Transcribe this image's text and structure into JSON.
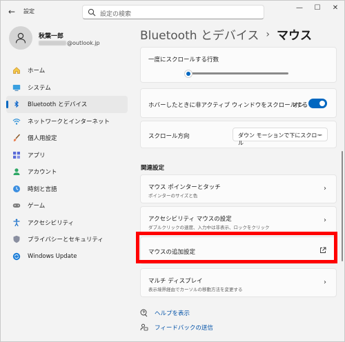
{
  "titlebar": {
    "app_title": "設定",
    "search_placeholder": "設定の検索",
    "back_glyph": "←",
    "minimize_glyph": "—",
    "maximize_glyph": "☐",
    "close_glyph": "✕"
  },
  "profile": {
    "name": "秋葉一郎",
    "email_suffix": "@outlook.jp"
  },
  "sidebar": {
    "items": [
      {
        "label": "ホーム",
        "icon": "home-icon"
      },
      {
        "label": "システム",
        "icon": "system-icon"
      },
      {
        "label": "Bluetooth とデバイス",
        "icon": "bluetooth-icon",
        "active": true
      },
      {
        "label": "ネットワークとインターネット",
        "icon": "network-icon"
      },
      {
        "label": "個人用設定",
        "icon": "brush-icon"
      },
      {
        "label": "アプリ",
        "icon": "apps-icon"
      },
      {
        "label": "アカウント",
        "icon": "account-icon"
      },
      {
        "label": "時刻と言語",
        "icon": "time-language-icon"
      },
      {
        "label": "ゲーム",
        "icon": "gaming-icon"
      },
      {
        "label": "アクセシビリティ",
        "icon": "accessibility-icon"
      },
      {
        "label": "プライバシーとセキュリティ",
        "icon": "shield-icon"
      },
      {
        "label": "Windows Update",
        "icon": "windows-update-icon"
      }
    ]
  },
  "header": {
    "parent": "Bluetooth とデバイス",
    "separator": "›",
    "current": "マウス"
  },
  "settings": {
    "scroll_lines_label": "一度にスクロールする行数",
    "scroll_lines_value_fraction": 0.03,
    "hover_scroll_label": "ホバーしたときに非アクティブ ウィンドウをスクロールする",
    "hover_scroll_state": "オン",
    "scroll_direction_label": "スクロール方向",
    "scroll_direction_value": "ダウン モーションで下にスクロール"
  },
  "related": {
    "title": "関連設定",
    "pointer_title": "マウス ポインターとタッチ",
    "pointer_sub": "ポインターのサイズと色",
    "accessibility_title": "アクセシビリティ マウスの設定",
    "accessibility_sub": "ダブルクリックの速度、入力中は非表示、ロックをクリック",
    "additional_title": "マウスの追加設定",
    "multi_display_title": "マルチ ディスプレイ",
    "multi_display_sub": "表示境界経由でカーソルの移動方法を変更する"
  },
  "links": {
    "help": "ヘルプを表示",
    "feedback": "フィードバックの送信"
  },
  "colors": {
    "accent": "#0067c0",
    "highlight": "#ff0000"
  }
}
